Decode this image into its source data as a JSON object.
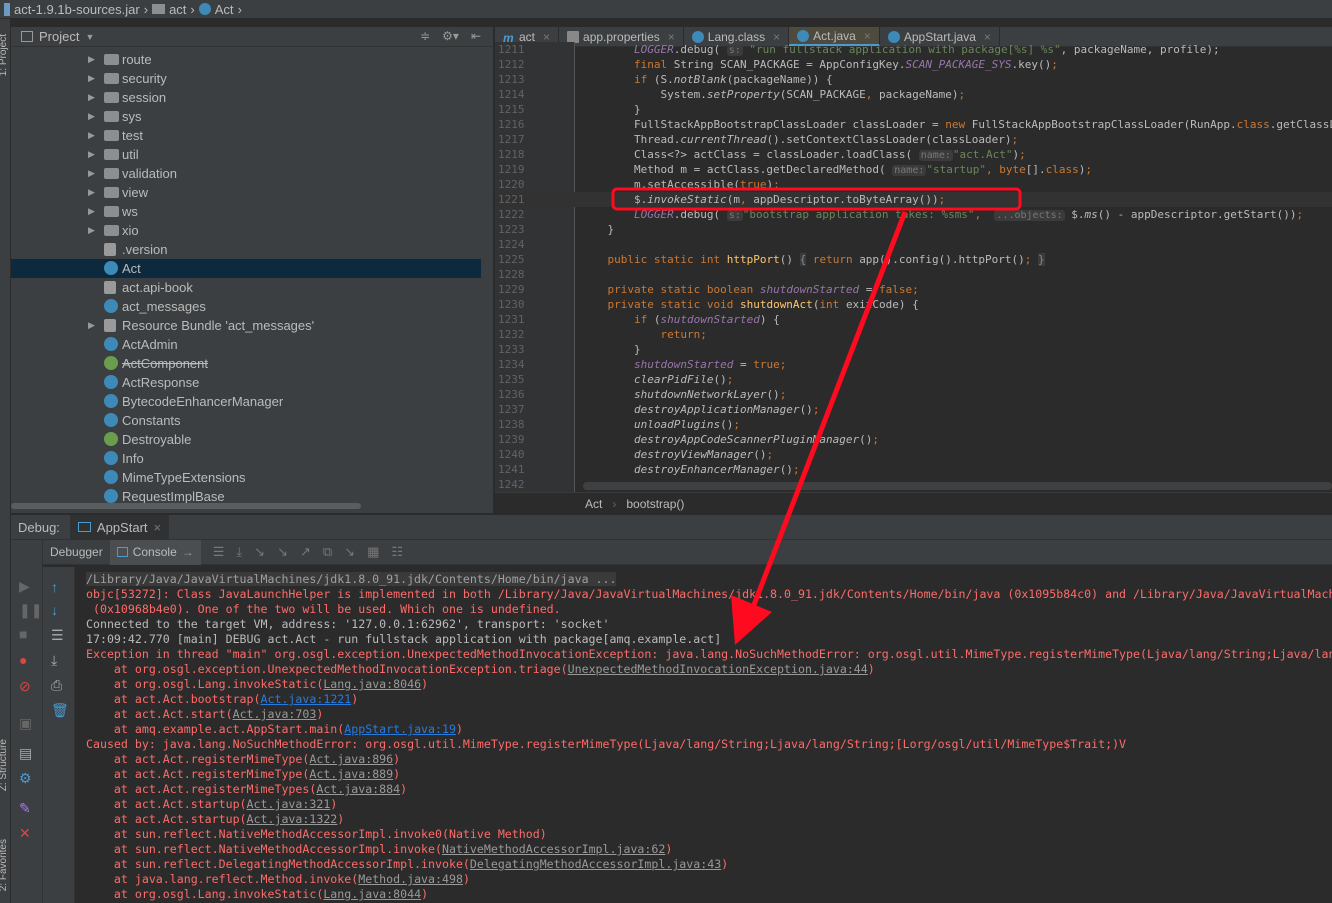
{
  "breadcrumb": [
    "act-1.9.1b-sources.jar",
    "act",
    "Act"
  ],
  "left_strip": {
    "project_label": "1: Project",
    "structure_label": "Z: Structure",
    "favorites_label": "2: Favorites"
  },
  "project": {
    "title": "Project",
    "items": [
      {
        "label": "route",
        "type": "folder",
        "expandable": true
      },
      {
        "label": "security",
        "type": "folder",
        "expandable": true
      },
      {
        "label": "session",
        "type": "folder",
        "expandable": true
      },
      {
        "label": "sys",
        "type": "folder",
        "expandable": true
      },
      {
        "label": "test",
        "type": "folder",
        "expandable": true
      },
      {
        "label": "util",
        "type": "folder",
        "expandable": true
      },
      {
        "label": "validation",
        "type": "folder",
        "expandable": true
      },
      {
        "label": "view",
        "type": "folder",
        "expandable": true
      },
      {
        "label": "ws",
        "type": "folder",
        "expandable": true
      },
      {
        "label": "xio",
        "type": "folder",
        "expandable": true
      },
      {
        "label": ".version",
        "type": "file"
      },
      {
        "label": "Act",
        "type": "cls",
        "selected": true
      },
      {
        "label": "act.api-book",
        "type": "file"
      },
      {
        "label": "act_messages",
        "type": "cls"
      },
      {
        "label": "Resource Bundle 'act_messages'",
        "type": "file",
        "expandable": true
      },
      {
        "label": "ActAdmin",
        "type": "cls"
      },
      {
        "label": "ActComponent",
        "type": "iface",
        "deprecated": true
      },
      {
        "label": "ActResponse",
        "type": "cls"
      },
      {
        "label": "BytecodeEnhancerManager",
        "type": "cls"
      },
      {
        "label": "Constants",
        "type": "cls"
      },
      {
        "label": "Destroyable",
        "type": "iface"
      },
      {
        "label": "Info",
        "type": "cls"
      },
      {
        "label": "MimeTypeExtensions",
        "type": "cls"
      },
      {
        "label": "RequestImplBase",
        "type": "cls"
      }
    ]
  },
  "editor": {
    "tabs": [
      {
        "label": "act",
        "icon": "maven-icon"
      },
      {
        "label": "app.properties",
        "icon": "properties-icon"
      },
      {
        "label": "Lang.class",
        "icon": "class-icon"
      },
      {
        "label": "Act.java",
        "icon": "class-icon",
        "active": true
      },
      {
        "label": "AppStart.java",
        "icon": "class-icon"
      }
    ],
    "lines": [
      {
        "n": "1211",
        "t": [
          [
            "        "
          ],
          [
            "LOGGER",
            "fld"
          ],
          [
            ".debug( "
          ],
          [
            "s:",
            "hint"
          ],
          [
            " \"run fullstack application with package[%s] %s\"",
            "str"
          ],
          [
            ", packageName, profile);"
          ]
        ]
      },
      {
        "n": "1212",
        "t": [
          [
            "        "
          ],
          [
            "final ",
            "kw"
          ],
          [
            "String SCAN_PACKAGE = AppConfigKey."
          ],
          [
            "SCAN_PACKAGE_SYS",
            "fld"
          ],
          [
            ".key()"
          ],
          [
            ";",
            "kw"
          ]
        ]
      },
      {
        "n": "1213",
        "t": [
          [
            "        "
          ],
          [
            "if ",
            "kw"
          ],
          [
            "(S."
          ],
          [
            "notBlank",
            "it"
          ],
          [
            "(packageName)) {"
          ]
        ]
      },
      {
        "n": "1214",
        "t": [
          [
            "            System."
          ],
          [
            "setProperty",
            "it"
          ],
          [
            "(SCAN_PACKAGE"
          ],
          [
            ", ",
            "kw"
          ],
          [
            "packageName)"
          ],
          [
            ";",
            "kw"
          ]
        ]
      },
      {
        "n": "1215",
        "t": [
          [
            "        }"
          ]
        ]
      },
      {
        "n": "1216",
        "t": [
          [
            "        FullStackAppBootstrapClassLoader classLoader = "
          ],
          [
            "new ",
            "kw"
          ],
          [
            "FullStackAppBootstrapClassLoader(RunApp."
          ],
          [
            "class",
            "kw"
          ],
          [
            ".getClassLoader());"
          ]
        ]
      },
      {
        "n": "1217",
        "t": [
          [
            "        Thread."
          ],
          [
            "currentThread",
            "it"
          ],
          [
            "().setContextClassLoader(classLoader)"
          ],
          [
            ";",
            "kw"
          ]
        ]
      },
      {
        "n": "1218",
        "t": [
          [
            "        Class<?> actClass = classLoader.loadClass( "
          ],
          [
            "name:",
            "hint"
          ],
          [
            "\"act.Act\"",
            "str"
          ],
          [
            ")"
          ],
          [
            ";",
            "kw"
          ]
        ]
      },
      {
        "n": "1219",
        "t": [
          [
            "        Method m = actClass.getDeclaredMethod( "
          ],
          [
            "name:",
            "hint"
          ],
          [
            "\"startup\"",
            "str"
          ],
          [
            ", ",
            "kw"
          ],
          [
            "byte",
            "kw"
          ],
          [
            "[]."
          ],
          [
            "class",
            "kw"
          ],
          [
            ")"
          ],
          [
            ";",
            "kw"
          ]
        ]
      },
      {
        "n": "1220",
        "t": [
          [
            "        m.setAccessible("
          ],
          [
            "true",
            "kw"
          ],
          [
            ")"
          ],
          [
            ";",
            "kw"
          ]
        ]
      },
      {
        "n": "1221",
        "cur": true,
        "t": [
          [
            "        $."
          ],
          [
            "invokeStatic",
            "it"
          ],
          [
            "(m"
          ],
          [
            ", ",
            "kw"
          ],
          [
            "appDescriptor.toByteArray())"
          ],
          [
            ";",
            "kw"
          ]
        ]
      },
      {
        "n": "1222",
        "t": [
          [
            "        "
          ],
          [
            "LOGGER",
            "fld"
          ],
          [
            ".debug( "
          ],
          [
            "s:",
            "hint"
          ],
          [
            "\"bootstrap application takes: %sms\"",
            "str"
          ],
          [
            ", ",
            "kw"
          ],
          [
            " "
          ],
          [
            "...objects:",
            "hint"
          ],
          [
            " $."
          ],
          [
            "ms",
            "it"
          ],
          [
            "() - appDescriptor.getStart())"
          ],
          [
            ";",
            "kw"
          ]
        ]
      },
      {
        "n": "1223",
        "t": [
          [
            "    }"
          ]
        ]
      },
      {
        "n": "1224",
        "t": [
          [
            ""
          ]
        ]
      },
      {
        "n": "1225",
        "t": [
          [
            "    "
          ],
          [
            "public static int ",
            "kw"
          ],
          [
            "httpPort",
            "dm"
          ],
          [
            "() "
          ],
          [
            "{",
            "fold"
          ],
          [
            " "
          ],
          [
            "return ",
            "kw"
          ],
          [
            "app().config().httpPort()"
          ],
          [
            ";",
            "kw"
          ],
          [
            " "
          ],
          [
            "}",
            "fold"
          ]
        ]
      },
      {
        "n": "1228",
        "t": [
          [
            ""
          ]
        ]
      },
      {
        "n": "1229",
        "t": [
          [
            "    "
          ],
          [
            "private static boolean ",
            "kw"
          ],
          [
            "shutdownStarted",
            "fld"
          ],
          [
            " = "
          ],
          [
            "false;",
            "kw"
          ]
        ]
      },
      {
        "n": "1230",
        "t": [
          [
            "    "
          ],
          [
            "private static void ",
            "kw"
          ],
          [
            "shutdownAct",
            "dm"
          ],
          [
            "("
          ],
          [
            "int ",
            "kw"
          ],
          [
            "exitCode) {"
          ]
        ]
      },
      {
        "n": "1231",
        "t": [
          [
            "        "
          ],
          [
            "if ",
            "kw"
          ],
          [
            "("
          ],
          [
            "shutdownStarted",
            "fld"
          ],
          [
            ") {"
          ]
        ]
      },
      {
        "n": "1232",
        "t": [
          [
            "            "
          ],
          [
            "return;",
            "kw"
          ]
        ]
      },
      {
        "n": "1233",
        "t": [
          [
            "        }"
          ]
        ]
      },
      {
        "n": "1234",
        "t": [
          [
            "        "
          ],
          [
            "shutdownStarted",
            "fld"
          ],
          [
            " = "
          ],
          [
            "true;",
            "kw"
          ]
        ]
      },
      {
        "n": "1235",
        "t": [
          [
            "        "
          ],
          [
            "clearPidFile",
            "it"
          ],
          [
            "()"
          ],
          [
            ";",
            "kw"
          ]
        ]
      },
      {
        "n": "1236",
        "t": [
          [
            "        "
          ],
          [
            "shutdownNetworkLayer",
            "it"
          ],
          [
            "()"
          ],
          [
            ";",
            "kw"
          ]
        ]
      },
      {
        "n": "1237",
        "t": [
          [
            "        "
          ],
          [
            "destroyApplicationManager",
            "it"
          ],
          [
            "()"
          ],
          [
            ";",
            "kw"
          ]
        ]
      },
      {
        "n": "1238",
        "t": [
          [
            "        "
          ],
          [
            "unloadPlugins",
            "it"
          ],
          [
            "()"
          ],
          [
            ";",
            "kw"
          ]
        ]
      },
      {
        "n": "1239",
        "t": [
          [
            "        "
          ],
          [
            "destroyAppCodeScannerPluginManager",
            "it"
          ],
          [
            "()"
          ],
          [
            ";",
            "kw"
          ]
        ]
      },
      {
        "n": "1240",
        "t": [
          [
            "        "
          ],
          [
            "destroyViewManager",
            "it"
          ],
          [
            "()"
          ],
          [
            ";",
            "kw"
          ]
        ]
      },
      {
        "n": "1241",
        "t": [
          [
            "        "
          ],
          [
            "destroyEnhancerManager",
            "it"
          ],
          [
            "()"
          ],
          [
            ";",
            "kw"
          ]
        ]
      },
      {
        "n": "1242",
        "t": [
          [
            ""
          ]
        ]
      }
    ],
    "crumbs": [
      "Act",
      "bootstrap()"
    ]
  },
  "debug": {
    "label": "Debug:",
    "config": "AppStart",
    "tabs": [
      "Debugger",
      "Console"
    ]
  },
  "console": [
    {
      "c": "gray",
      "t": [
        [
          "/Library/Java/JavaVirtualMachines/jdk1.8.0_91.jdk/Contents/Home/bin/java ...",
          "first"
        ]
      ]
    },
    {
      "c": "red",
      "t": [
        [
          "objc[53272]: Class JavaLaunchHelper is implemented in both /Library/Java/JavaVirtualMachines/jdk1.8.0_91.jdk/Contents/Home/bin/java (0x1095b84c0) and /Library/Java/JavaVirtualMachines/jdk1.8.0_91.jdk/Contents/Home/jre/lib/libinstrument.dylib"
        ]
      ]
    },
    {
      "c": "red",
      "t": [
        [
          " (0x10968b4e0). One of the two will be used. Which one is undefined."
        ]
      ]
    },
    {
      "c": "white",
      "t": [
        [
          "Connected to the target VM, address: '127.0.0.1:62962', transport: 'socket'"
        ]
      ]
    },
    {
      "c": "white",
      "t": [
        [
          "17:09:42.770 [main] DEBUG act.Act - run fullstack application with package[amq.example.act]"
        ]
      ]
    },
    {
      "c": "red",
      "t": [
        [
          "Exception in thread \"main\" org.osgl.exception.UnexpectedMethodInvocationException: java.lang.NoSuchMethodError: org.osgl.util.MimeType.registerMimeType(Ljava/lang/String;Ljava/lang/String;[Lorg/osgl/util/MimeType$Trait;)V"
        ]
      ]
    },
    {
      "c": "red",
      "t": [
        [
          "    at org.osgl.exception.UnexpectedMethodInvocationException.triage("
        ],
        [
          "UnexpectedMethodInvocationException.java:44",
          "ulnk"
        ],
        [
          ")"
        ]
      ]
    },
    {
      "c": "red",
      "t": [
        [
          "    at org.osgl.Lang.invokeStatic("
        ],
        [
          "Lang.java:8046",
          "ulnk"
        ],
        [
          ")"
        ]
      ]
    },
    {
      "c": "red",
      "t": [
        [
          "    at act.Act.bootstrap("
        ],
        [
          "Act.java:1221",
          "lnk"
        ],
        [
          ")"
        ]
      ]
    },
    {
      "c": "red",
      "t": [
        [
          "    at act.Act.start("
        ],
        [
          "Act.java:703",
          "ulnk"
        ],
        [
          ")"
        ]
      ]
    },
    {
      "c": "red",
      "t": [
        [
          "    at amq.example.act.AppStart.main("
        ],
        [
          "AppStart.java:19",
          "lnk"
        ],
        [
          ")"
        ]
      ]
    },
    {
      "c": "red",
      "t": [
        [
          "Caused by: java.lang.NoSuchMethodError: org.osgl.util.MimeType.registerMimeType(Ljava/lang/String;Ljava/lang/String;[Lorg/osgl/util/MimeType$Trait;)V"
        ]
      ]
    },
    {
      "c": "red",
      "t": [
        [
          "    at act.Act.registerMimeType("
        ],
        [
          "Act.java:896",
          "ulnk"
        ],
        [
          ")"
        ]
      ]
    },
    {
      "c": "red",
      "t": [
        [
          "    at act.Act.registerMimeType("
        ],
        [
          "Act.java:889",
          "ulnk"
        ],
        [
          ")"
        ]
      ]
    },
    {
      "c": "red",
      "t": [
        [
          "    at act.Act.registerMimeTypes("
        ],
        [
          "Act.java:884",
          "ulnk"
        ],
        [
          ")"
        ]
      ]
    },
    {
      "c": "red",
      "t": [
        [
          "    at act.Act.startup("
        ],
        [
          "Act.java:321",
          "ulnk"
        ],
        [
          ")"
        ]
      ]
    },
    {
      "c": "red",
      "t": [
        [
          "    at act.Act.startup("
        ],
        [
          "Act.java:1322",
          "ulnk"
        ],
        [
          ")"
        ]
      ]
    },
    {
      "c": "red",
      "t": [
        [
          "    at sun.reflect.NativeMethodAccessorImpl.invoke0(Native Method)"
        ]
      ]
    },
    {
      "c": "red",
      "t": [
        [
          "    at sun.reflect.NativeMethodAccessorImpl.invoke("
        ],
        [
          "NativeMethodAccessorImpl.java:62",
          "ulnk"
        ],
        [
          ")"
        ]
      ]
    },
    {
      "c": "red",
      "t": [
        [
          "    at sun.reflect.DelegatingMethodAccessorImpl.invoke("
        ],
        [
          "DelegatingMethodAccessorImpl.java:43",
          "ulnk"
        ],
        [
          ")"
        ]
      ]
    },
    {
      "c": "red",
      "t": [
        [
          "    at java.lang.reflect.Method.invoke("
        ],
        [
          "Method.java:498",
          "ulnk"
        ],
        [
          ")"
        ]
      ]
    },
    {
      "c": "red",
      "t": [
        [
          "    at org.osgl.Lang.invokeStatic("
        ],
        [
          "Lang.java:8044",
          "ulnk"
        ],
        [
          ")"
        ]
      ]
    }
  ],
  "colors": {
    "annotation": "#ff0a1e",
    "error_text": "#ff6b68",
    "selection": "#0d293e",
    "link": "#287bde"
  }
}
